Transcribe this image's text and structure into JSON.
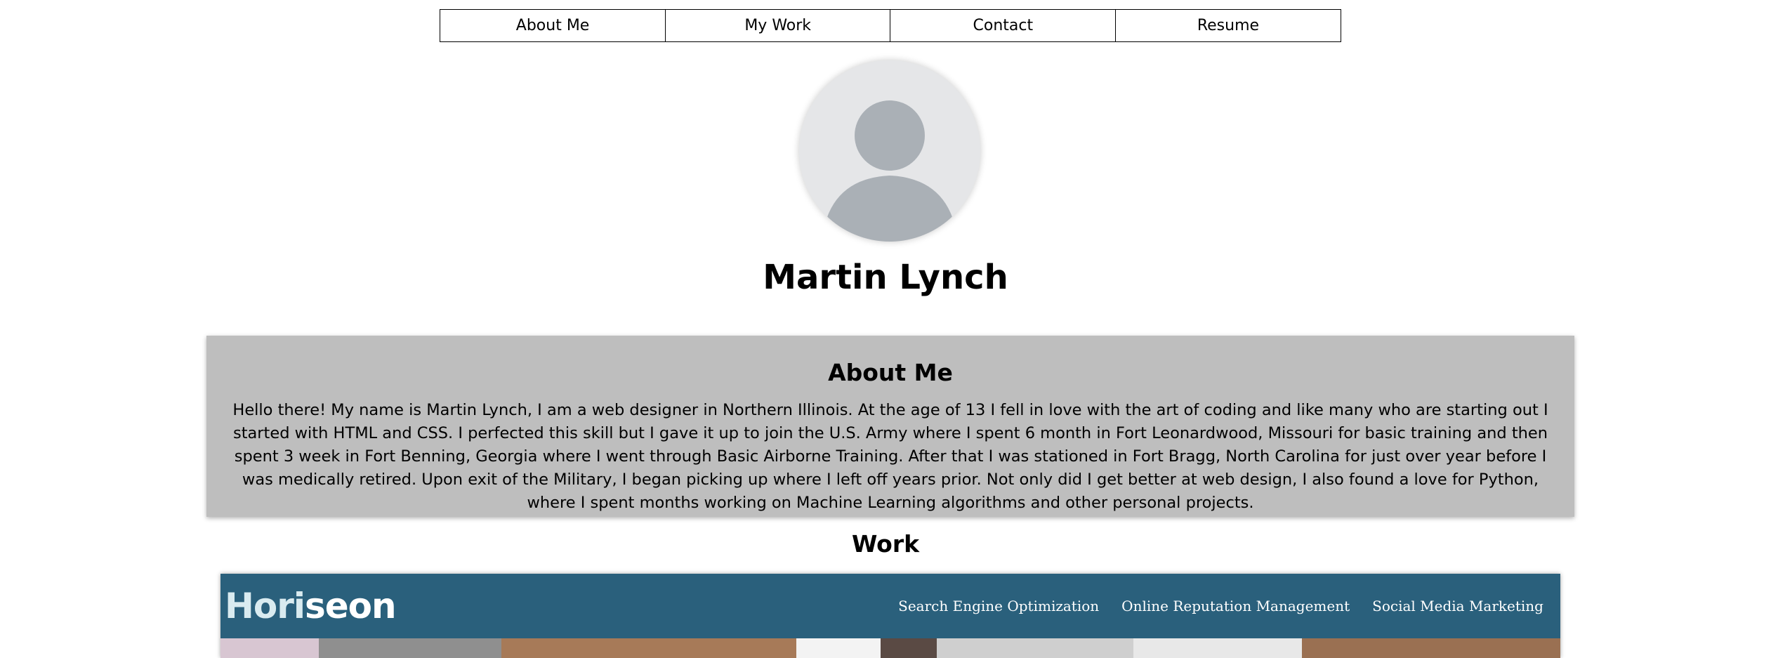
{
  "nav": {
    "items": [
      "About Me",
      "My Work",
      "Contact",
      "Resume"
    ]
  },
  "profile": {
    "avatar_icon": "user-placeholder-icon",
    "name": "Martin Lynch"
  },
  "about": {
    "heading": "About Me",
    "body": "Hello there! My name is Martin Lynch, I am a web designer in Northern Illinois. At the age of 13 I fell in love with the art of coding and like many who are starting out I started with HTML and CSS. I perfected this skill but I gave it up to join the U.S. Army where I spent 6 month in Fort Leonardwood, Missouri for basic training and then spent 3 week in Fort Benning, Georgia where I went through Basic Airborne Training. After that I was stationed in Fort Bragg, North Carolina for just over year before I was medically retired. Upon exit of the Military, I began picking up where I left off years prior. Not only did I get better at web design, I also found a love for Python, where I spent months working on Machine Learning algorithms and other personal projects."
  },
  "work": {
    "heading": "Work",
    "project": {
      "logo_main": "Hori",
      "logo_accent": "seon",
      "nav": [
        "Search Engine Optimization",
        "Online Reputation Management",
        "Social Media Marketing"
      ]
    }
  },
  "colors": {
    "about_bg": "#bebebe",
    "horiseon_header": "#2a607c"
  }
}
